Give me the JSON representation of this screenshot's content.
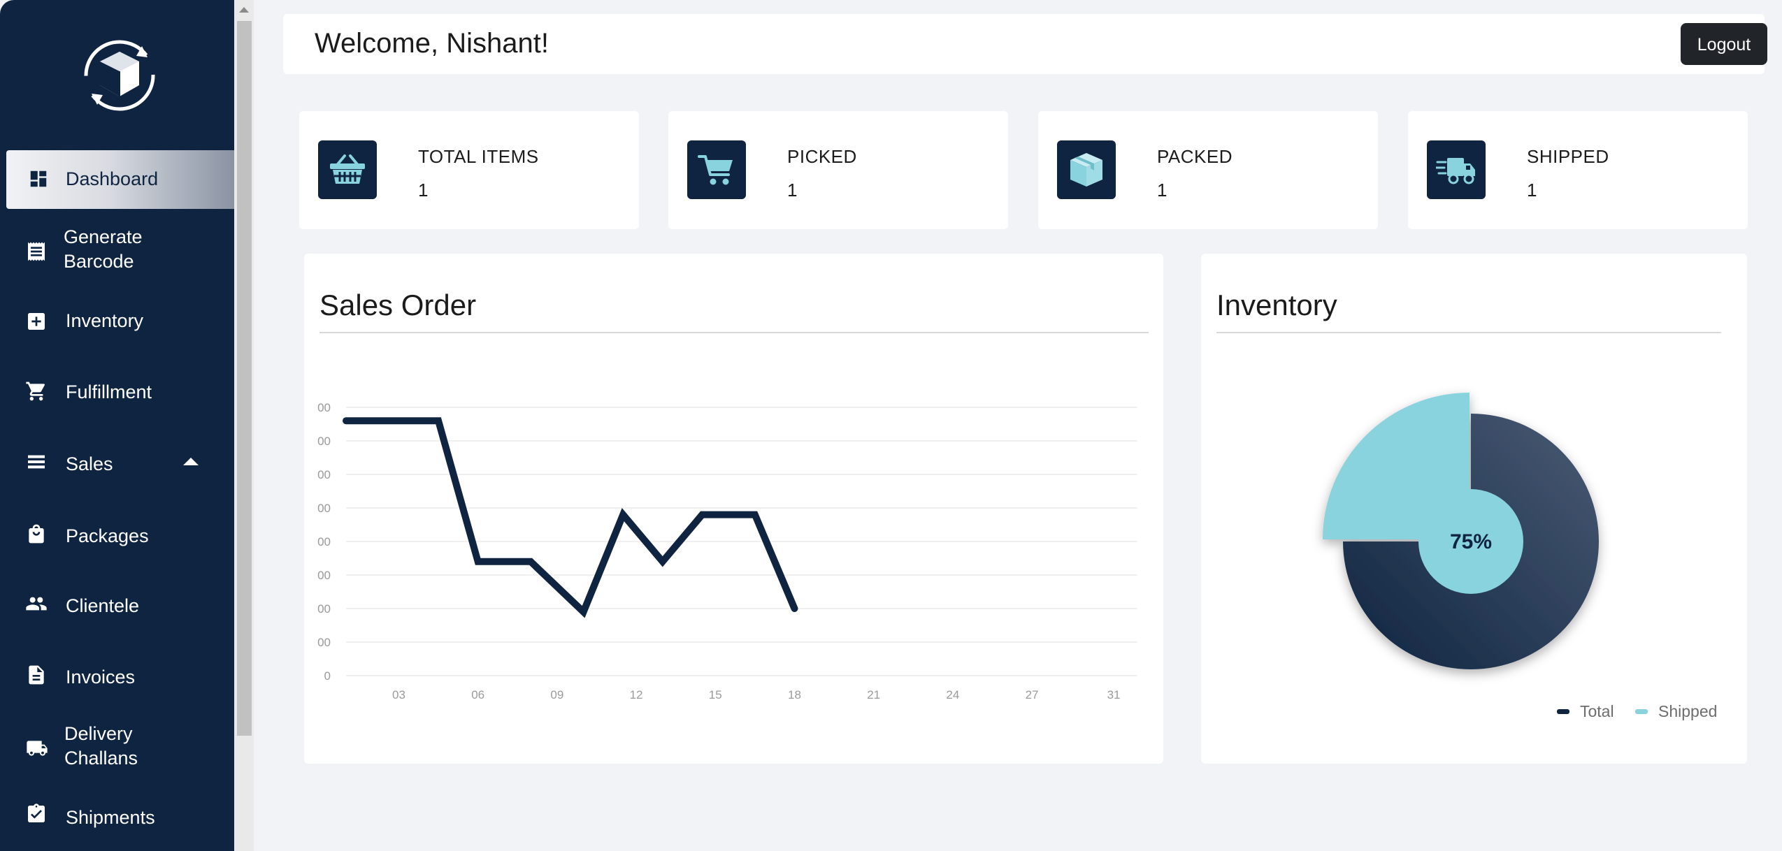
{
  "sidebar": {
    "items": [
      {
        "label": "Dashboard",
        "icon": "dashboard-icon",
        "active": true
      },
      {
        "label": "Generate\nBarcode",
        "line1": "Generate",
        "line2": "Barcode",
        "icon": "receipt-icon"
      },
      {
        "label": "Inventory",
        "icon": "add-box-icon"
      },
      {
        "label": "Fulfillment",
        "icon": "cart-icon"
      },
      {
        "label": "Sales",
        "icon": "list-icon",
        "expanded": true
      },
      {
        "label": "Packages",
        "icon": "shopping-bag-icon"
      },
      {
        "label": "Clientele",
        "icon": "people-icon"
      },
      {
        "label": "Invoices",
        "icon": "document-icon"
      },
      {
        "label": "Delivery\nChallans",
        "line1": "Delivery",
        "line2": "Challans",
        "icon": "truck-icon"
      },
      {
        "label": "Shipments",
        "icon": "clipboard-check-icon"
      }
    ]
  },
  "header": {
    "welcome": "Welcome, Nishant!",
    "logout_label": "Logout"
  },
  "stats": [
    {
      "label": "TOTAL ITEMS",
      "value": "1",
      "icon": "basket-icon"
    },
    {
      "label": "PICKED",
      "value": "1",
      "icon": "cart-icon"
    },
    {
      "label": "PACKED",
      "value": "1",
      "icon": "box-icon"
    },
    {
      "label": "SHIPPED",
      "value": "1",
      "icon": "fast-truck-icon"
    }
  ],
  "sales_panel": {
    "title": "Sales Order"
  },
  "inventory_panel": {
    "title": "Inventory"
  },
  "colors": {
    "sidebar": "#0f2440",
    "accent": "#88d3de",
    "line": "#0f2440",
    "total": "#1c2e48",
    "shipped": "#88d3de"
  },
  "chart_data": [
    {
      "type": "line",
      "title": "Sales Order",
      "x_ticks": [
        "03",
        "06",
        "09",
        "12",
        "15",
        "18",
        "21",
        "24",
        "27",
        "31"
      ],
      "y_ticks": [
        "0",
        "00",
        "00",
        "00",
        "00",
        "00",
        "00",
        "00",
        "00"
      ],
      "x": [
        1,
        4.5,
        6,
        8,
        10,
        11.5,
        13,
        14.5,
        16.5,
        18
      ],
      "y": [
        7.6,
        7.6,
        3.4,
        3.4,
        1.9,
        4.8,
        3.4,
        4.8,
        4.8,
        2.0
      ],
      "xlim": [
        1,
        31
      ],
      "ylim": [
        0,
        8
      ],
      "grid": true
    },
    {
      "type": "pie",
      "title": "Inventory",
      "labels": [
        "Total",
        "Shipped"
      ],
      "values": [
        75,
        25
      ],
      "center_label": "75%",
      "legend": "bottom-right"
    }
  ]
}
